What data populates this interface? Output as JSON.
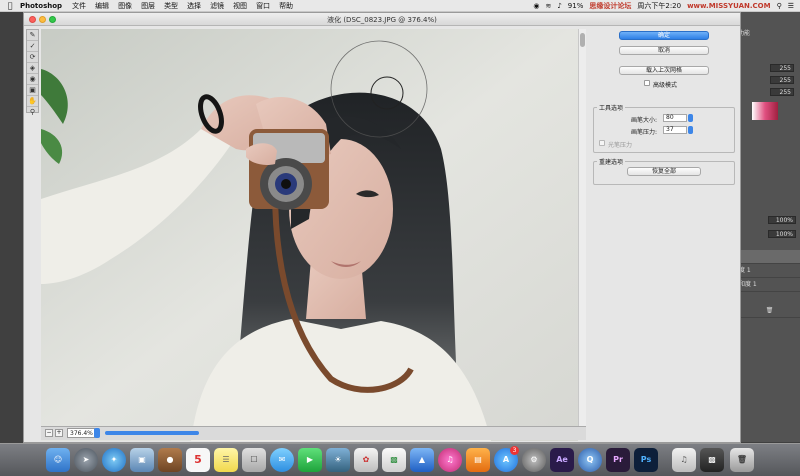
{
  "menubar": {
    "app_name": "Photoshop",
    "menus": [
      "文件",
      "编辑",
      "图像",
      "图层",
      "类型",
      "选择",
      "滤镜",
      "视图",
      "窗口",
      "帮助"
    ],
    "battery": "91%",
    "clock": "周六下午2:20",
    "watermark_left": "思缘设计论坛",
    "watermark_right": "www.MISSYUAN.COM"
  },
  "dialog": {
    "title": "液化 (DSC_0823.JPG @ 376.4%)",
    "zoom": "376.4%",
    "ok_label": "确定",
    "cancel_label": "取消",
    "load_mesh_label": "载入上次网格",
    "advanced_mode_label": "高级模式",
    "tool_options": {
      "title": "工具选项",
      "brush_size_label": "画笔大小:",
      "brush_size_value": "80",
      "brush_pressure_label": "画笔压力:",
      "brush_pressure_value": "37",
      "stylus_label": "光笔压力"
    },
    "reconstruct": {
      "title": "重建选项",
      "restore_all_label": "恢复全部"
    }
  },
  "ps_panels": {
    "rgb": [
      "255",
      "255",
      "255"
    ],
    "opacity": "100%",
    "fill": "100%",
    "layers": [
      "度 1",
      "和度 1"
    ],
    "top_label": "功能"
  },
  "dock": {
    "calendar_day": "5",
    "ae": "Ae",
    "pr": "Pr",
    "ps": "Ps",
    "appstore_badge": "3"
  },
  "colors": {
    "accent": "#2e7fe6",
    "dialog_bg": "#e6e6e6",
    "ps_panel": "#535353"
  }
}
